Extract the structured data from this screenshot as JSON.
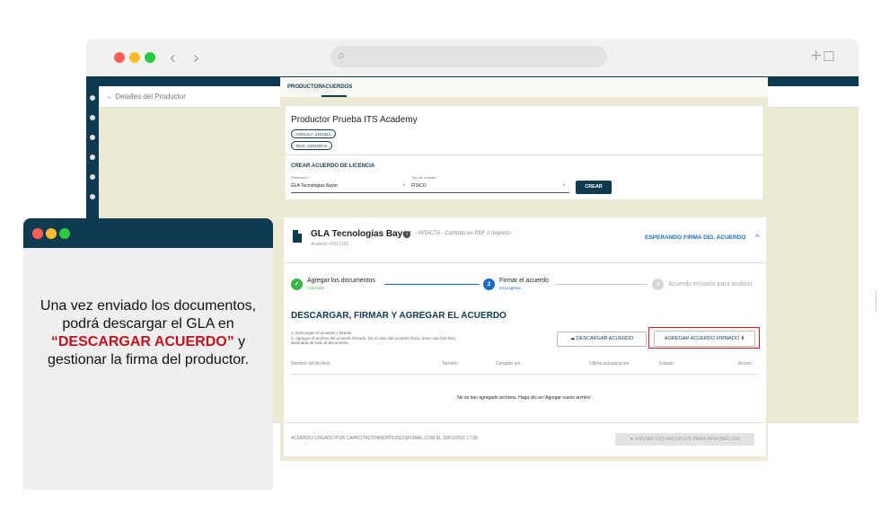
{
  "browser": {
    "nav_arrows": "‹ ›",
    "search_icon": "search-icon",
    "new_tab_icon": "new-tab-icon",
    "traffic_colors": [
      "#ff5f57",
      "#febc2e",
      "#28c840"
    ]
  },
  "app": {
    "page_title": "← Detalles del Productor",
    "tabs": [
      "PRODUCTOR",
      "ACUERDOS"
    ],
    "producer": {
      "name": "Productor Prueba ITS Academy",
      "cedula": "CEDULA: 2344321",
      "ruc": "RUC: 2344321-9"
    },
    "create": {
      "title": "CREAR ACUERDO DE LICENCIA",
      "platform_label": "Plataforma *",
      "platform_value": "GLA Tecnologías Bayer",
      "contract_label": "Tipo de contrato *",
      "contract_value": "FÍSICO",
      "clear_icon": "close-icon",
      "create_button": "CREAR"
    },
    "agreement": {
      "title": "GLA Tecnologías Bayer",
      "meta": "- INTACTA - Contrato en PDF o Impreso",
      "number": "Acuerdo #0013165",
      "status": "ESPERANDO FIRMA DEL ACUERDO",
      "chevron": "^"
    },
    "steps": [
      {
        "num": "✓",
        "label": "Agregar los documentos",
        "sub": "concluido"
      },
      {
        "num": "2",
        "label": "Firmar el acuerdo",
        "sub": "en progreso"
      },
      {
        "num": "3",
        "label": "Acuerdo enviado para análisis",
        "sub": ""
      }
    ],
    "download": {
      "title": "DESCARGAR, FIRMAR Y AGREGAR EL ACUERDO",
      "instructions": "1. Descargue el acuerdo y firmelo.\n2. Agregue el archivo del acuerdo firmado. En el caso del acuerdo físico, tome una foto bien iluminada de todo el documento.",
      "download_button": "DESCARGAR ACUERDO",
      "upload_button": "AGREGAR ACUERDO FIRMADO"
    },
    "table": {
      "headers": [
        "Nombre del Archivo",
        "Tamaño",
        "Cargado por",
        "Última actualización",
        "Estado",
        "Acción"
      ],
      "empty": "No se han agregado archivos. Haga clic en 'Agregar nuevo archivo'."
    },
    "footer": {
      "created": "ACUERDO CREADO POR CAPACITACIONNORTE2022@GMAIL.COM EL 20/01/2026 17:26",
      "send_button": "ENVIAR LOS ARCHIVOS PARA APROBACIÓN"
    }
  },
  "callout": {
    "text_before": "Una vez enviado los documentos, podrá descargar el GLA en",
    "highlight": "“DESCARGAR ACUERDO”",
    "text_after": "y gestionar la firma del productor."
  },
  "colors": {
    "navy": "#0f3b50",
    "accent_blue": "#1a6cc3",
    "done_green": "#3bb54a",
    "highlight_red": "#c1121f",
    "box_red": "#e11b1b"
  }
}
